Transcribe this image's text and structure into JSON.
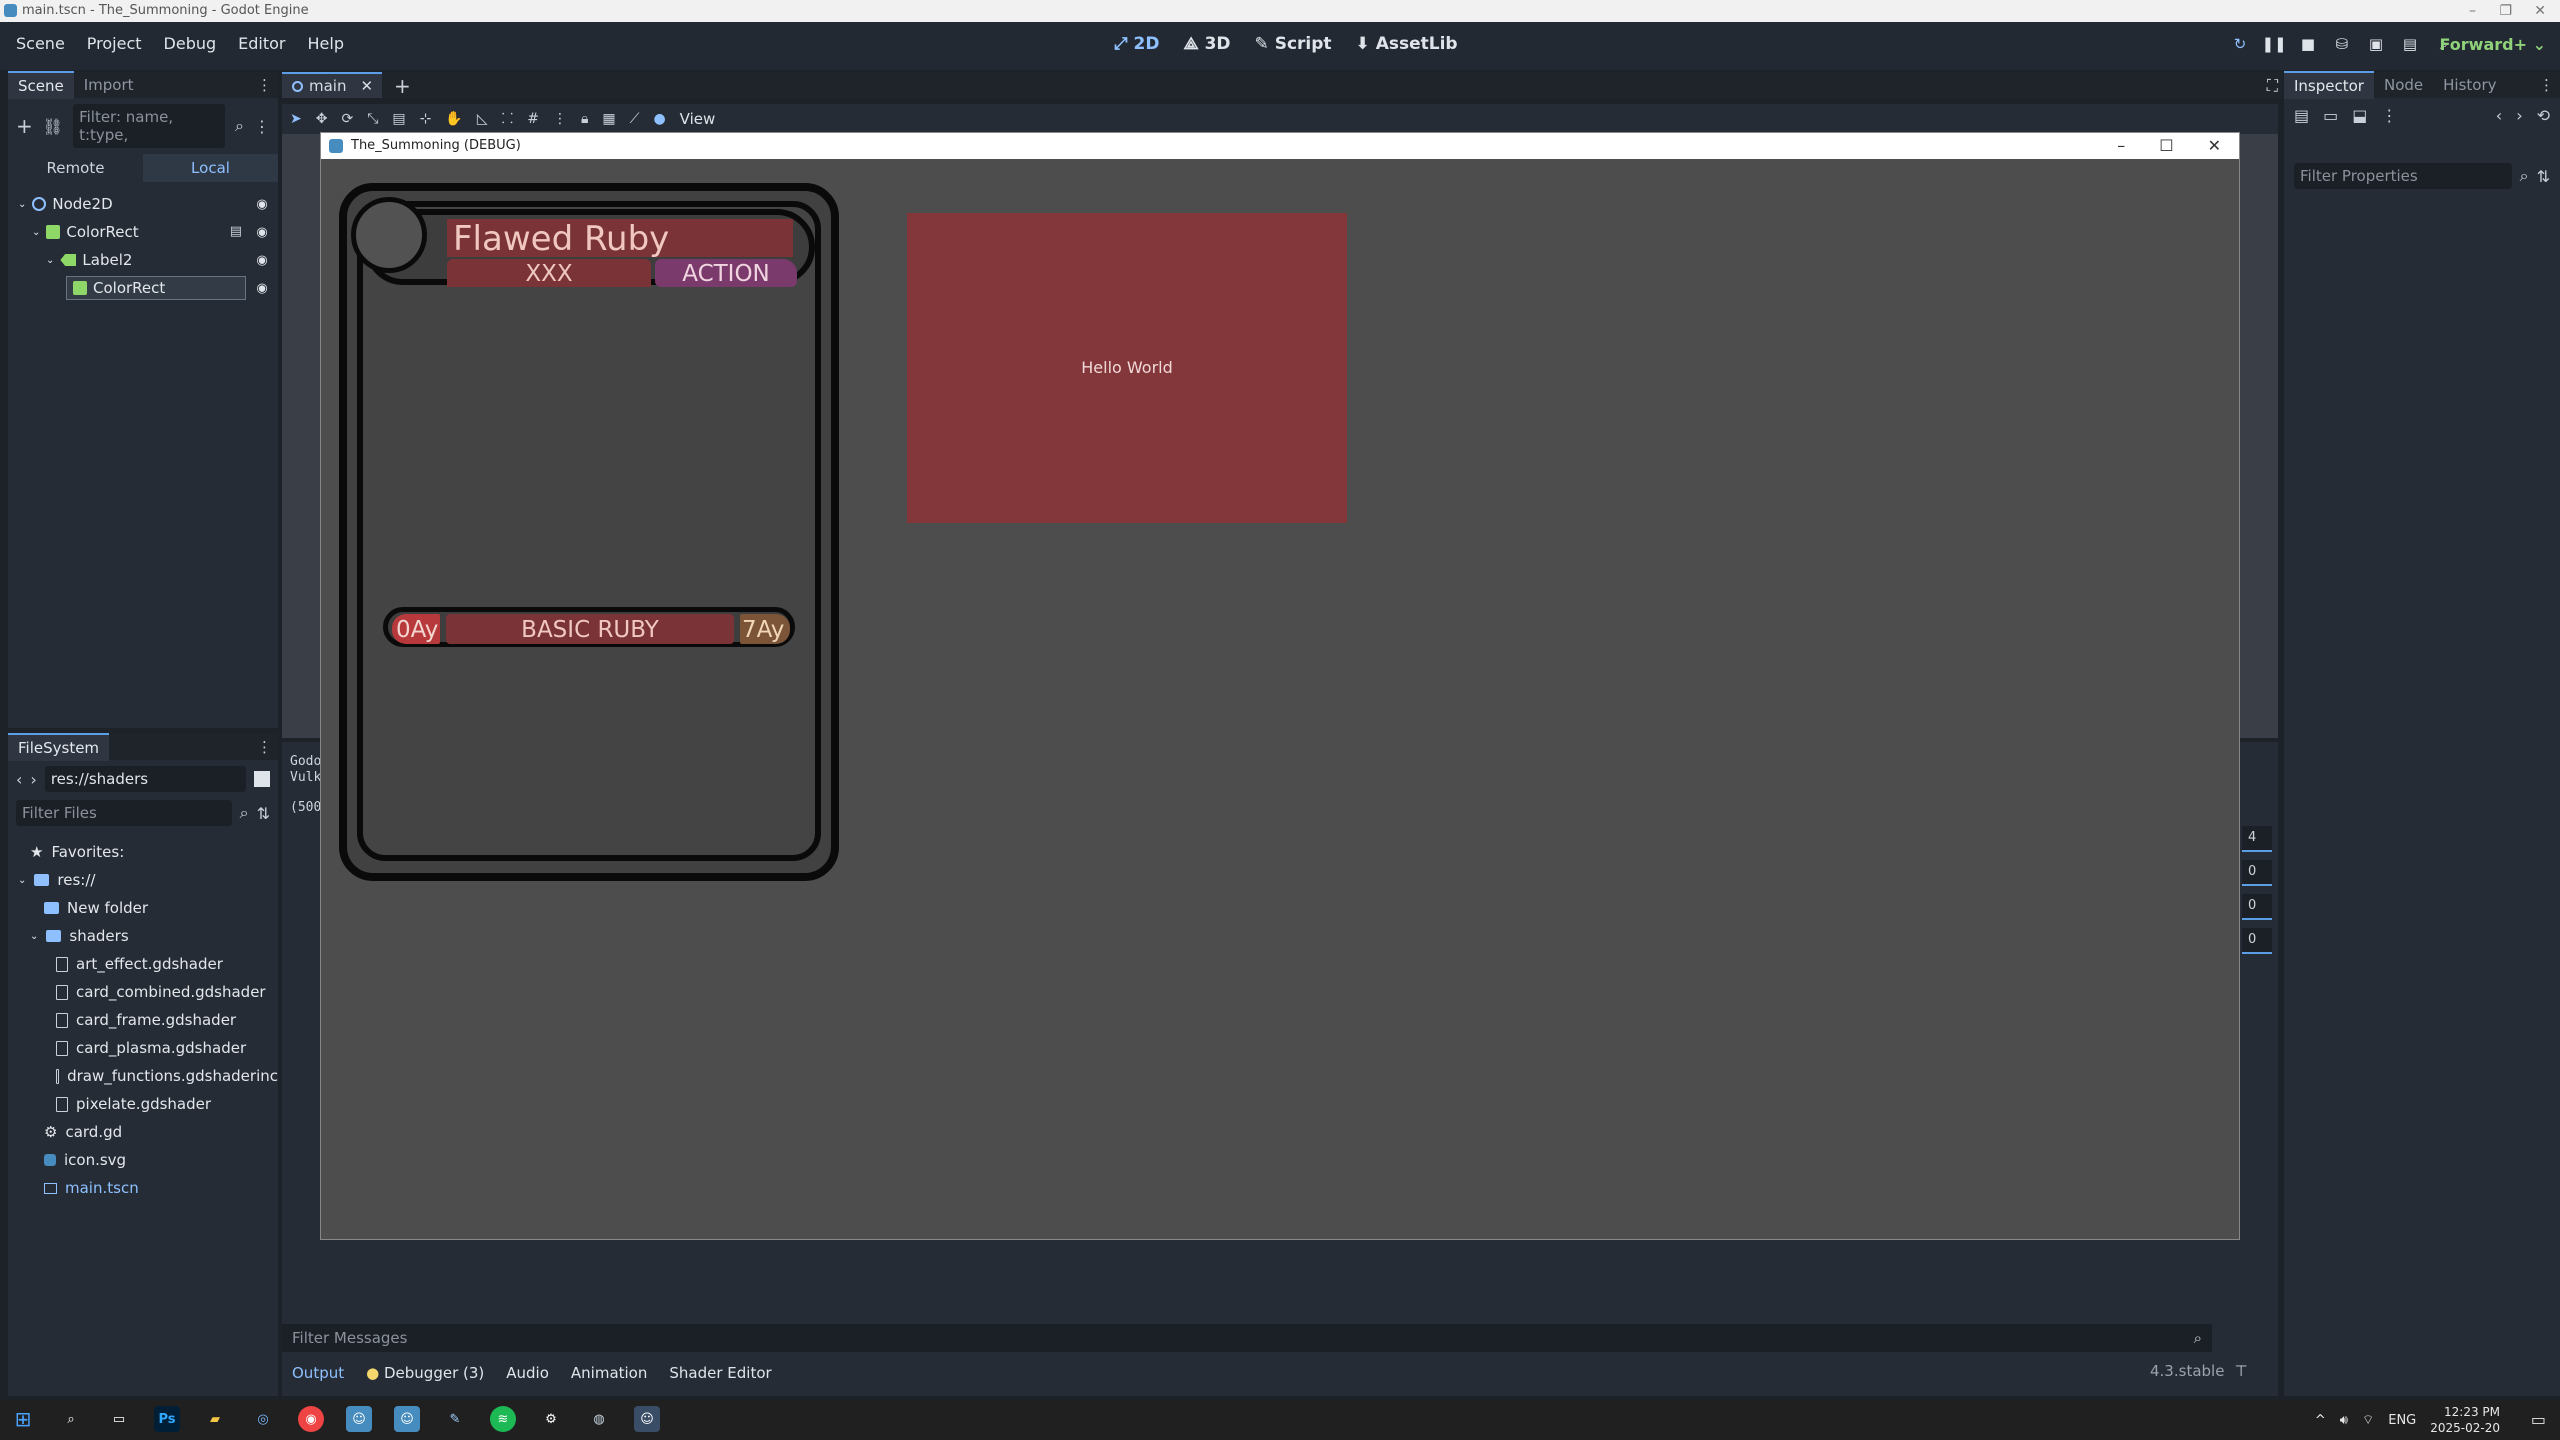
{
  "window_title": "main.tscn - The_Summoning - Godot Engine",
  "menus": [
    "Scene",
    "Project",
    "Debug",
    "Editor",
    "Help"
  ],
  "main_screens": [
    "2D",
    "3D",
    "Script",
    "AssetLib"
  ],
  "renderer": "Forward+",
  "scene_dock": {
    "tabs": [
      "Scene",
      "Import"
    ],
    "filter_placeholder": "Filter: name, t:type,",
    "remote": "Remote",
    "local": "Local",
    "tree": [
      "Node2D",
      "ColorRect",
      "Label2",
      "ColorRect"
    ]
  },
  "filesystem": {
    "tab": "FileSystem",
    "path": "res://shaders",
    "filter_placeholder": "Filter Files",
    "favorites": "Favorites:",
    "root": "res://",
    "items": [
      "New folder",
      "shaders",
      "art_effect.gdshader",
      "card_combined.gdshader",
      "card_frame.gdshader",
      "card_plasma.gdshader",
      "draw_functions.gdshaderinc",
      "pixelate.gdshader",
      "card.gd",
      "icon.svg",
      "main.tscn"
    ]
  },
  "center": {
    "tab": "main",
    "view_menu": "View",
    "log_lines": [
      "Godo",
      "Vulk",
      "(500"
    ]
  },
  "inspector": {
    "tabs": [
      "Inspector",
      "Node",
      "History"
    ],
    "filter_placeholder": "Filter Properties"
  },
  "right_inputs": [
    "4",
    "0",
    "0",
    "0"
  ],
  "game_window": {
    "title": "The_Summoning (DEBUG)",
    "card": {
      "name": "Flawed Ruby",
      "subtitle": "XXX",
      "action": "ACTION",
      "cost": "0Ay",
      "type": "BASIC RUBY",
      "power": "7Ay"
    },
    "hello": "Hello World"
  },
  "bottom": {
    "filter_placeholder": "Filter Messages",
    "tabs": [
      "Output",
      "Debugger (3)",
      "Audio",
      "Animation",
      "Shader Editor"
    ],
    "version": "4.3.stable"
  },
  "taskbar": {
    "lang": "ENG",
    "time": "12:23 PM",
    "date": "2025-02-20"
  },
  "colors": {
    "accent": "#5c9ee6",
    "card_red": "#7a3337",
    "hello_rect": "#83373a"
  }
}
